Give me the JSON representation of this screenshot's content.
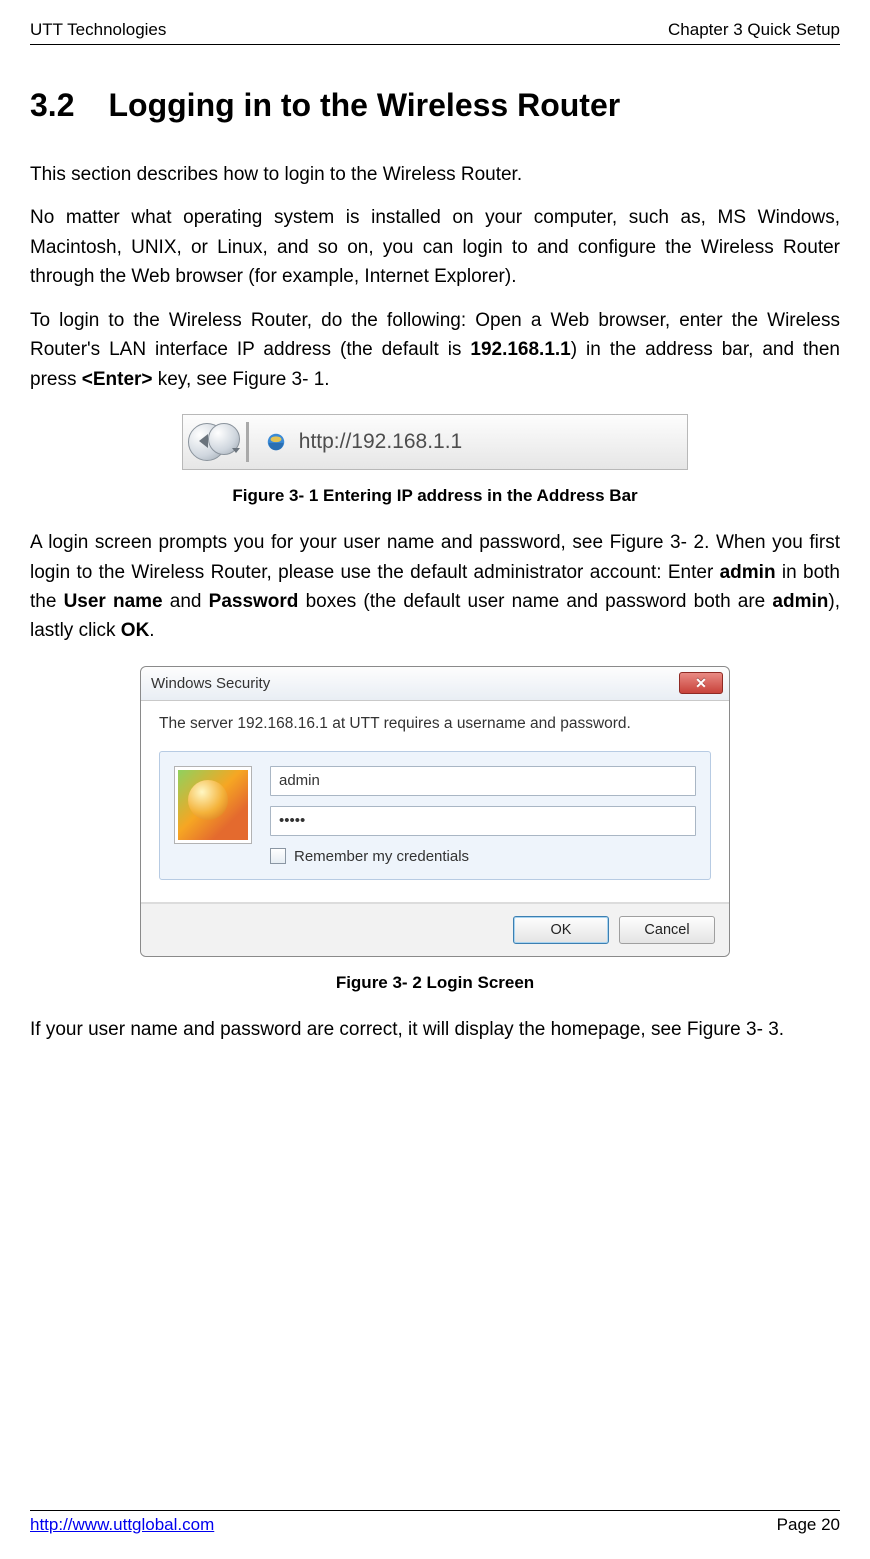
{
  "header": {
    "left": "UTT Technologies",
    "right": "Chapter 3 Quick Setup"
  },
  "footer": {
    "url": "http://www.uttglobal.com",
    "page": "Page 20"
  },
  "section": {
    "number": "3.2",
    "title": "Logging in to the Wireless Router"
  },
  "p1": "This section describes how to login to the Wireless Router.",
  "p2": "No matter what operating system is installed on your computer, such as, MS Windows, Macintosh, UNIX, or Linux, and so on, you can login to and configure the Wireless Router through the Web browser (for example, Internet Explorer).",
  "p3_a": "To login to the Wireless Router, do the following: Open a Web browser, enter the Wireless Router's LAN interface IP address (the default is ",
  "p3_ip": "192.168.1.1",
  "p3_b": ") in the address bar, and then press ",
  "p3_enter": "<Enter>",
  "p3_c": " key, see Figure 3- 1.",
  "fig1": {
    "url_text": "http://192.168.1.1",
    "caption": "Figure 3- 1 Entering IP address in the Address Bar"
  },
  "p4_a": "A login screen prompts you for your user name and password, see Figure 3- 2. When you first login to the Wireless Router, please use the default administrator account: Enter ",
  "p4_admin": "admin",
  "p4_b": " in both the ",
  "p4_user": "User name",
  "p4_c": " and ",
  "p4_pass": "Password",
  "p4_d": " boxes (the default user name and password both are ",
  "p4_admin2": "admin",
  "p4_e": "), lastly click ",
  "p4_ok": "OK",
  "p4_f": ".",
  "dialog": {
    "title": "Windows Security",
    "message": "The server 192.168.16.1 at UTT requires a username and password.",
    "username": "admin",
    "password": "•••••",
    "remember": "Remember my credentials",
    "ok": "OK",
    "cancel": "Cancel"
  },
  "fig2": {
    "caption": "Figure 3- 2 Login Screen"
  },
  "p5": "If your user name and password are correct, it will display the homepage, see Figure 3- 3."
}
